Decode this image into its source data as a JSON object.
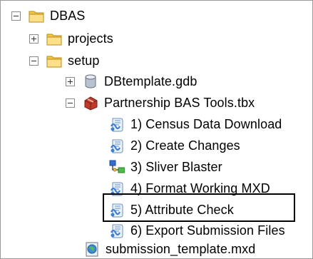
{
  "tree": {
    "root": {
      "label": "DBAS",
      "icon": "folder-icon",
      "toggle": "minus"
    },
    "projects": {
      "label": "projects",
      "icon": "folder-icon",
      "toggle": "plus"
    },
    "setup": {
      "label": "setup",
      "icon": "folder-icon",
      "toggle": "minus"
    },
    "gdb": {
      "label": "DBtemplate.gdb",
      "icon": "database-icon",
      "toggle": "plus"
    },
    "toolbox": {
      "label": "Partnership BAS Tools.tbx",
      "icon": "toolbox-icon",
      "toggle": "minus"
    },
    "tools": [
      {
        "label": "1) Census Data Download",
        "icon": "script-icon"
      },
      {
        "label": "2) Create Changes",
        "icon": "script-icon"
      },
      {
        "label": "3) Sliver Blaster",
        "icon": "model-icon"
      },
      {
        "label": "4) Format Working MXD",
        "icon": "script-icon"
      },
      {
        "label": "5) Attribute Check",
        "icon": "script-icon",
        "highlighted": true
      },
      {
        "label": "6) Export Submission Files",
        "icon": "script-icon"
      }
    ],
    "mxd": {
      "label": "submission_template.mxd",
      "icon": "map-document-icon"
    }
  },
  "colors": {
    "folder": "#f3c848",
    "highlight_border": "#000000",
    "script_blue": "#3f7fd0",
    "toolbox_red": "#c0392b"
  }
}
